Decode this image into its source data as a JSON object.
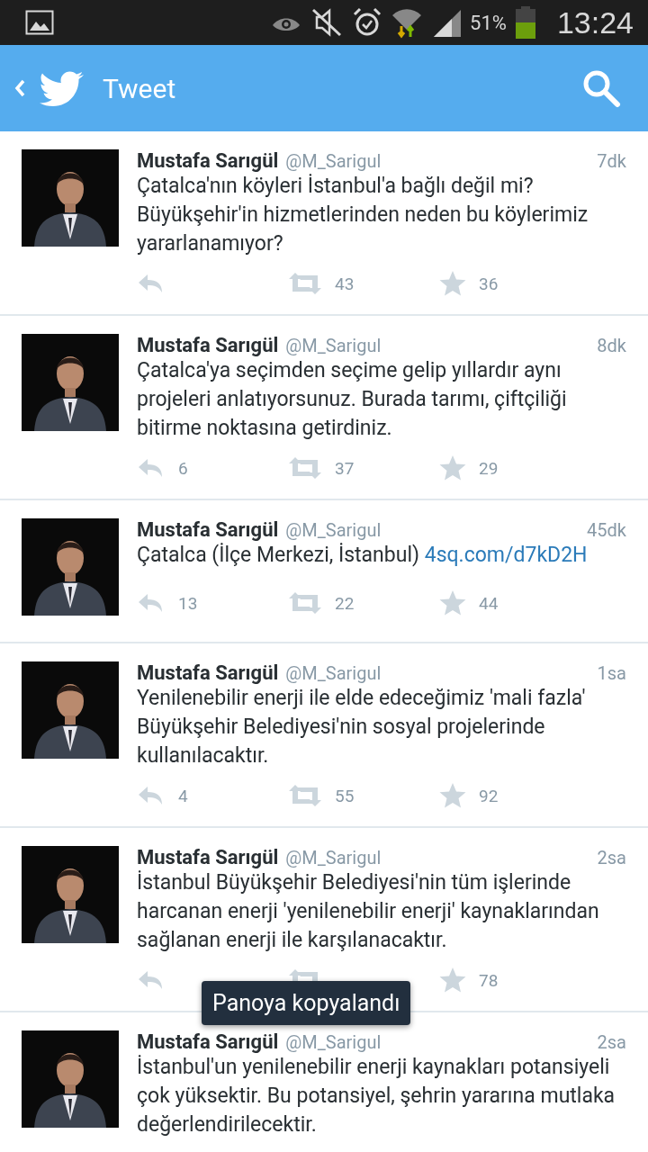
{
  "status_bar": {
    "battery_text": "51%",
    "time": "13:24"
  },
  "header": {
    "title": "Tweet"
  },
  "tweets": [
    {
      "name": "Mustafa Sarıgül",
      "handle": "@M_Sarigul",
      "time": "7dk",
      "text": "Çatalca'nın köyleri İstanbul'a bağlı değil mi? Büyükşehir'in hizmetlerinden neden bu köylerimiz yararlanamıyor?",
      "retweets": "43",
      "favorites": "36"
    },
    {
      "name": "Mustafa Sarıgül",
      "handle": "@M_Sarigul",
      "time": "8dk",
      "text": "Çatalca'ya seçimden seçime gelip yıllardır aynı projeleri anlatıyorsunuz. Burada tarımı, çiftçiliği bitirme noktasına getirdiniz.",
      "replies": "6",
      "retweets": "37",
      "favorites": "29"
    },
    {
      "name": "Mustafa Sarıgül",
      "handle": "@M_Sarigul",
      "time": "45dk",
      "text": "Çatalca (İlçe Merkezi, İstanbul)",
      "link": "4sq.com/d7kD2H",
      "replies": "13",
      "retweets": "22",
      "favorites": "44"
    },
    {
      "name": "Mustafa Sarıgül",
      "handle": "@M_Sarigul",
      "time": "1sa",
      "text": "Yenilenebilir enerji ile elde edeceğimiz 'mali fazla' Büyükşehir Belediyesi'nin sosyal projelerinde kullanılacaktır.",
      "replies": "4",
      "retweets": "55",
      "favorites": "92"
    },
    {
      "name": "Mustafa Sarıgül",
      "handle": "@M_Sarigul",
      "time": "2sa",
      "text": "İstanbul Büyükşehir Belediyesi'nin tüm işlerinde harcanan enerji 'yenilenebilir enerji' kaynaklarından sağlanan enerji ile karşılanacaktır.",
      "favorites": "78"
    },
    {
      "name": "Mustafa Sarıgül",
      "handle": "@M_Sarigul",
      "time": "2sa",
      "text": "İstanbul'un yenilenebilir enerji kaynakları potansiyeli çok yüksektir. Bu potansiyel, şehrin yararına mutlaka değerlendirilecektir."
    }
  ],
  "toast": {
    "text": "Panoya kopyalandı"
  }
}
